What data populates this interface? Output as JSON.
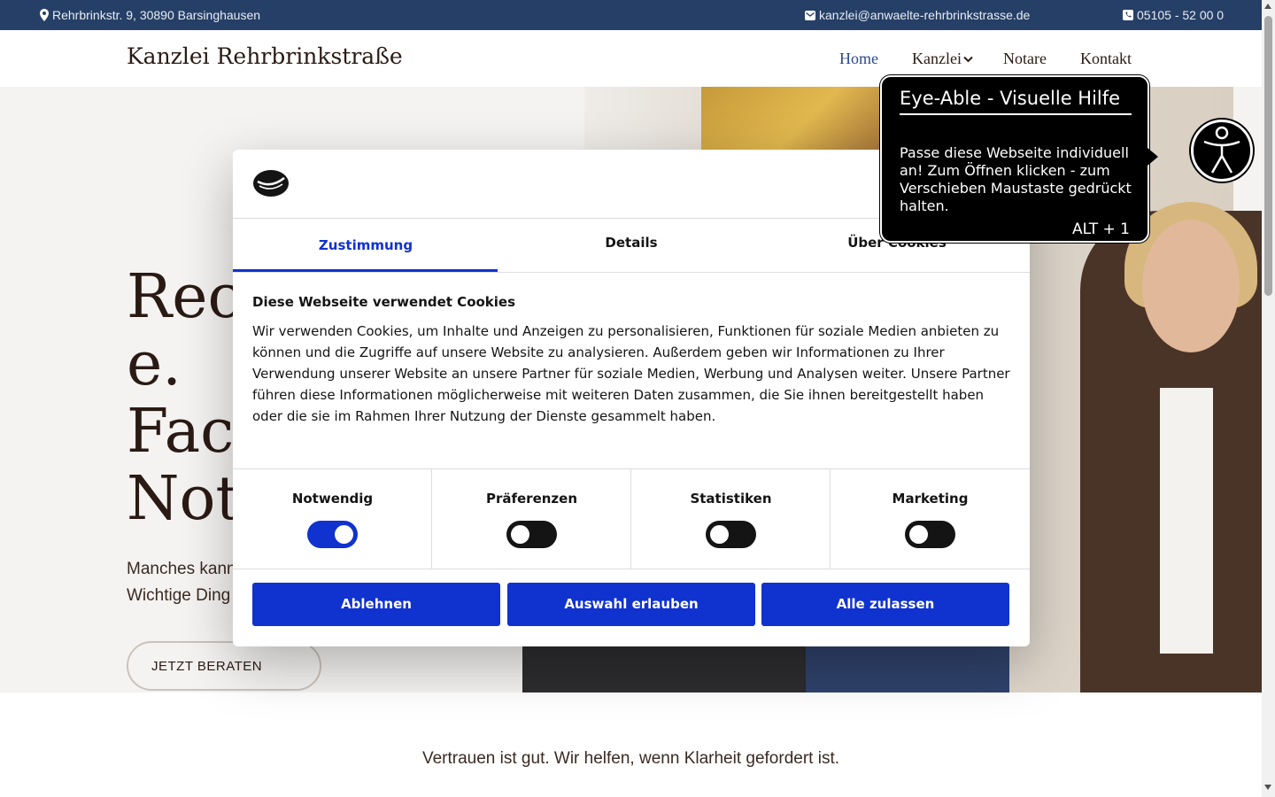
{
  "topbar": {
    "address": "Rehrbrinkstr. 9, 30890 Barsinghausen",
    "email": "kanzlei@anwaelte-rehrbrinkstrasse.de",
    "phone": "05105 - 52 00 0"
  },
  "header": {
    "brand": "Kanzlei Rehrbrinkstraße",
    "nav": {
      "home": "Home",
      "kanzlei": "Kanzlei",
      "notare": "Notare",
      "kontakt": "Kontakt"
    }
  },
  "hero": {
    "title": "Rec\ne.\nFac\nNot",
    "subtitle": "Manches kann\nWichtige Ding",
    "button": "JETZT BERATEN"
  },
  "below": {
    "tagline": "Vertrauen ist gut. Wir helfen, wenn Klarheit gefordert ist."
  },
  "cookie_dialog": {
    "tabs": {
      "consent": "Zustimmung",
      "details": "Details",
      "about": "Über Cookies"
    },
    "heading": "Diese Webseite verwendet Cookies",
    "text": "Wir verwenden Cookies, um Inhalte und Anzeigen zu personalisieren, Funktionen für soziale Medien anbieten zu können und die Zugriffe auf unsere Website zu analysieren. Außerdem geben wir Informationen zu Ihrer Verwendung unserer Website an unsere Partner für soziale Medien, Werbung und Analysen weiter. Unsere Partner führen diese Informationen möglicherweise mit weiteren Daten zusammen, die Sie ihnen bereitgestellt haben oder die sie im Rahmen Ihrer Nutzung der Dienste gesammelt haben.",
    "categories": {
      "necessary": "Notwendig",
      "preferences": "Präferenzen",
      "statistics": "Statistiken",
      "marketing": "Marketing"
    },
    "buttons": {
      "decline": "Ablehnen",
      "allow_selection": "Auswahl erlauben",
      "allow_all": "Alle zulassen"
    },
    "accent_color": "#1032cf"
  },
  "eye_able": {
    "title": "Eye-Able - Visuelle Hilfe",
    "body": "Passe diese Webseite individuell an! Zum Öffnen klicken - zum Verschieben Maustaste gedrückt halten.",
    "shortcut": "ALT + 1"
  },
  "colors": {
    "topbar": "#263f66",
    "nav_active": "#2c4a8a",
    "text_dark": "#2a1a14"
  }
}
